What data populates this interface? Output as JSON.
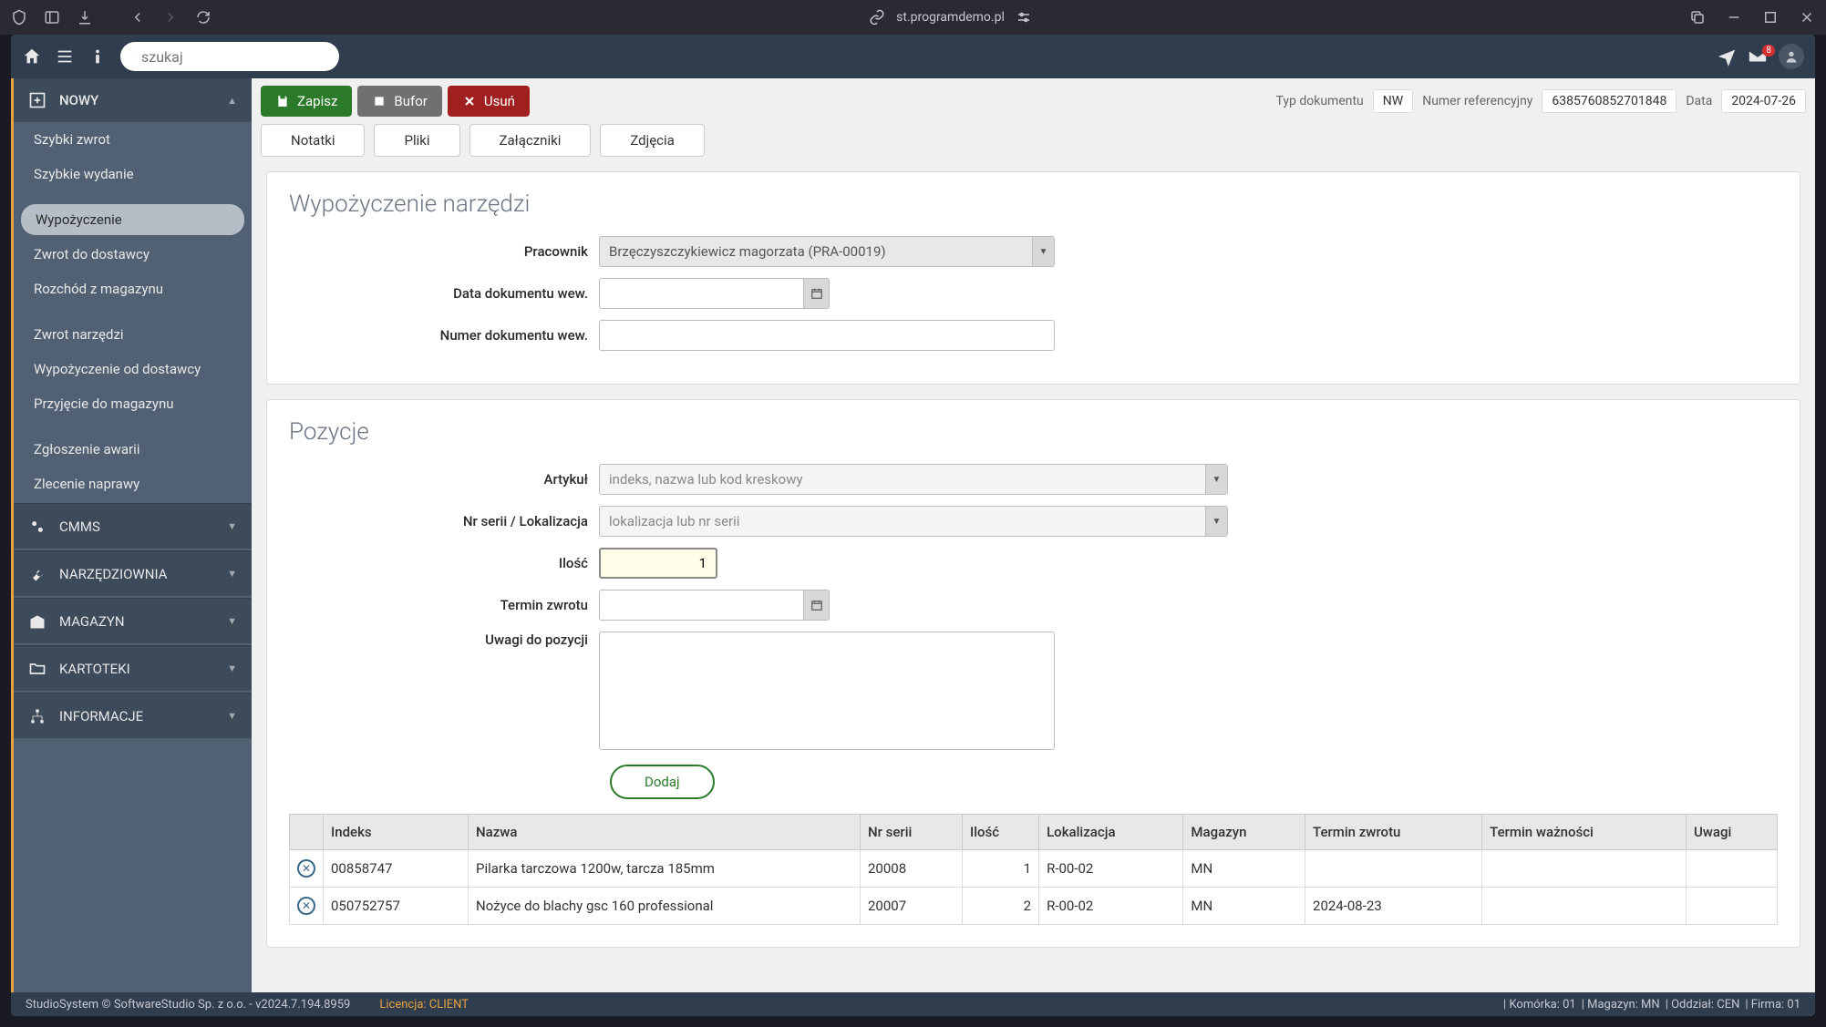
{
  "chrome": {
    "url": "st.programdemo.pl"
  },
  "header": {
    "search_placeholder": "szukaj",
    "mail_count": "8"
  },
  "sidebar": {
    "section_new": "NOWY",
    "items1": [
      "Szybki zwrot",
      "Szybkie wydanie"
    ],
    "items2": [
      "Wypożyczenie",
      "Zwrot do dostawcy",
      "Rozchód z magazynu"
    ],
    "items3": [
      "Zwrot narzędzi",
      "Wypożyczenie od dostawcy",
      "Przyjęcie do magazynu"
    ],
    "items4": [
      "Zgłoszenie awarii",
      "Zlecenie naprawy"
    ],
    "sections": {
      "cmms": "CMMS",
      "narzedziownia": "NARZĘDZIOWNIA",
      "magazyn": "MAGAZYN",
      "kartoteki": "KARTOTEKI",
      "informacje": "INFORMACJE"
    }
  },
  "toolbar": {
    "save": "Zapisz",
    "buffer": "Bufor",
    "delete": "Usuń",
    "doc_type_label": "Typ dokumentu",
    "doc_type_value": "NW",
    "ref_label": "Numer referencyjny",
    "ref_value": "6385760852701848",
    "date_label": "Data",
    "date_value": "2024-07-26"
  },
  "tabs": [
    "Notatki",
    "Pliki",
    "Załączniki",
    "Zdjęcia"
  ],
  "panel1": {
    "title": "Wypożyczenie narzędzi",
    "employee_label": "Pracownik",
    "employee_value": "Brzęczyszczykiewicz magorzata (PRA-00019)",
    "doc_date_label": "Data dokumentu wew.",
    "doc_num_label": "Numer dokumentu wew."
  },
  "panel2": {
    "title": "Pozycje",
    "article_label": "Artykuł",
    "article_placeholder": "indeks, nazwa lub kod kreskowy",
    "serial_label": "Nr serii / Lokalizacja",
    "serial_placeholder": "lokalizacja lub nr serii",
    "qty_label": "Ilość",
    "qty_value": "1",
    "return_label": "Termin zwrotu",
    "notes_label": "Uwagi do pozycji",
    "add_button": "Dodaj"
  },
  "table": {
    "headers": {
      "indeks": "Indeks",
      "nazwa": "Nazwa",
      "nr_serii": "Nr serii",
      "ilosc": "Ilość",
      "lokalizacja": "Lokalizacja",
      "magazyn": "Magazyn",
      "termin_zwrotu": "Termin zwrotu",
      "termin_waznosci": "Termin ważności",
      "uwagi": "Uwagi"
    },
    "rows": [
      {
        "indeks": "00858747",
        "nazwa": "Pilarka tarczowa 1200w, tarcza 185mm",
        "nr_serii": "20008",
        "ilosc": "1",
        "lokalizacja": "R-00-02",
        "magazyn": "MN",
        "termin_zwrotu": "",
        "termin_waznosci": "",
        "uwagi": ""
      },
      {
        "indeks": "050752757",
        "nazwa": "Nożyce do blachy gsc 160 professional",
        "nr_serii": "20007",
        "ilosc": "2",
        "lokalizacja": "R-00-02",
        "magazyn": "MN",
        "termin_zwrotu": "2024-08-23",
        "termin_waznosci": "",
        "uwagi": ""
      }
    ]
  },
  "footer": {
    "copyright": "StudioSystem © SoftwareStudio Sp. z o.o. - v2024.7.194.8959",
    "license": "Licencja: CLIENT",
    "komorka": "| Komórka: 01",
    "magazyn": "| Magazyn: MN",
    "oddzial": "| Oddział: CEN",
    "firma": "| Firma: 01"
  }
}
